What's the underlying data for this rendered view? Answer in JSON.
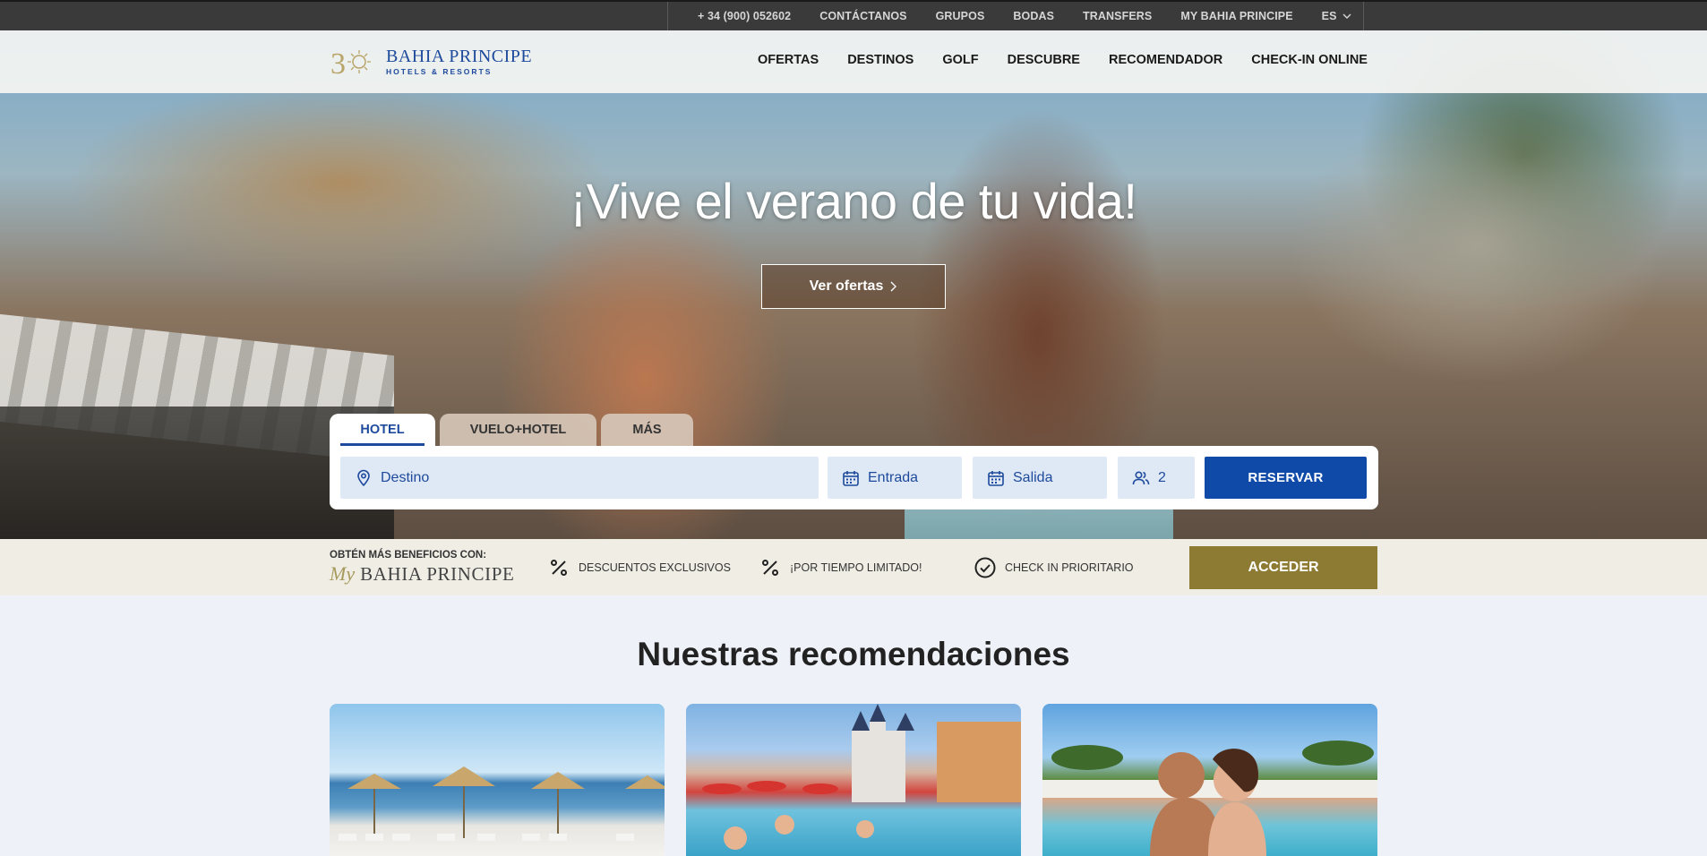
{
  "topbar": {
    "phone": "+ 34 (900) 052602",
    "links": [
      "CONTÁCTANOS",
      "GRUPOS",
      "BODAS",
      "TRANSFERS",
      "MY BAHIA PRINCIPE"
    ],
    "language": "ES"
  },
  "brand": {
    "name": "BAHIA PRINCIPE",
    "sub": "HOTELS & RESORTS",
    "color": "#1d4a9c"
  },
  "nav": [
    "OFERTAS",
    "DESTINOS",
    "GOLF",
    "DESCUBRE",
    "RECOMENDADOR",
    "CHECK-IN ONLINE"
  ],
  "hero": {
    "title": "¡Vive el verano de tu vida!",
    "cta": "Ver ofertas"
  },
  "booking": {
    "tabs": [
      "HOTEL",
      "VUELO+HOTEL",
      "MÁS"
    ],
    "active_tab": "HOTEL",
    "destination_placeholder": "Destino",
    "checkin_placeholder": "Entrada",
    "checkout_placeholder": "Salida",
    "guests": "2",
    "submit": "RESERVAR",
    "accent": "#0f4aa8"
  },
  "benefits": {
    "lead": "OBTÉN MÁS BENEFICIOS CON:",
    "program_my": "My",
    "program_name": "BAHIA PRINCIPE",
    "items": [
      "DESCUENTOS EXCLUSIVOS",
      "¡POR TIEMPO LIMITADO!",
      "CHECK IN PRIORITARIO"
    ],
    "button": "ACCEDER",
    "button_color": "#8d7a33"
  },
  "recommendations": {
    "title": "Nuestras recomendaciones"
  }
}
